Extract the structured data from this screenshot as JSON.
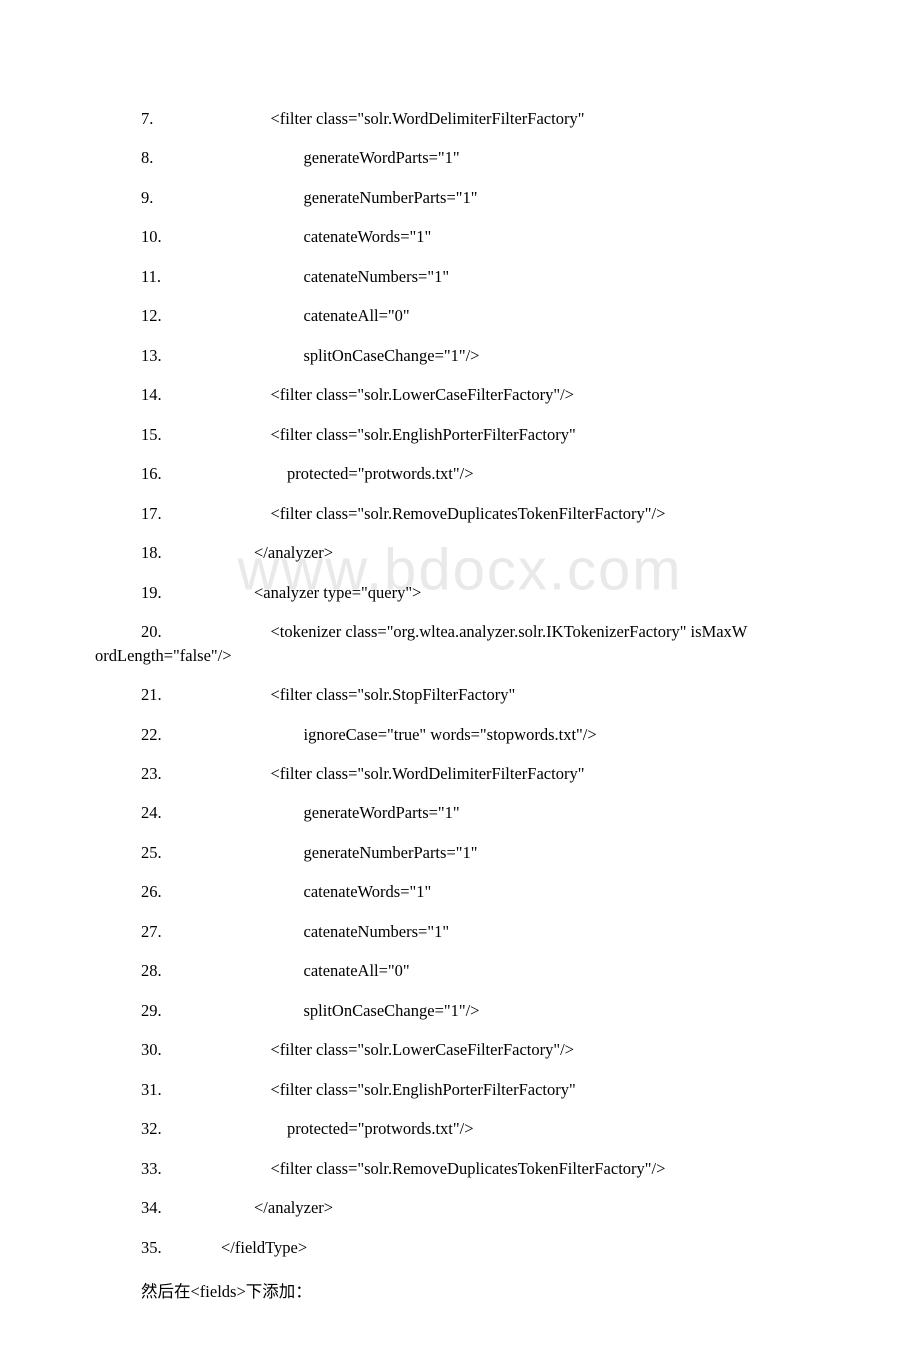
{
  "watermark": "www.bdocx.com",
  "lines": [
    {
      "n": "7",
      "t": "            <filter class=\"solr.WordDelimiterFilterFactory\""
    },
    {
      "n": "8",
      "t": "                    generateWordParts=\"1\""
    },
    {
      "n": "9",
      "t": "                    generateNumberParts=\"1\""
    },
    {
      "n": "10",
      "t": "                    catenateWords=\"1\""
    },
    {
      "n": "11",
      "t": "                    catenateNumbers=\"1\""
    },
    {
      "n": "12",
      "t": "                    catenateAll=\"0\""
    },
    {
      "n": "13",
      "t": "                    splitOnCaseChange=\"1\"/>"
    },
    {
      "n": "14",
      "t": "            <filter class=\"solr.LowerCaseFilterFactory\"/>"
    },
    {
      "n": "15",
      "t": "            <filter class=\"solr.EnglishPorterFilterFactory\""
    },
    {
      "n": "16",
      "t": "                protected=\"protwords.txt\"/>"
    },
    {
      "n": "17",
      "t": "            <filter class=\"solr.RemoveDuplicatesTokenFilterFactory\"/>"
    },
    {
      "n": "18",
      "t": "        </analyzer>"
    },
    {
      "n": "19",
      "t": "        <analyzer type=\"query\">"
    },
    {
      "n": "20",
      "t": "            <tokenizer class=\"org.wltea.analyzer.solr.IKTokenizerFactory\" isMaxW",
      "wrap": "ordLength=\"false\"/>"
    },
    {
      "n": "21",
      "t": "            <filter class=\"solr.StopFilterFactory\""
    },
    {
      "n": "22",
      "t": "                    ignoreCase=\"true\" words=\"stopwords.txt\"/>"
    },
    {
      "n": "23",
      "t": "            <filter class=\"solr.WordDelimiterFilterFactory\""
    },
    {
      "n": "24",
      "t": "                    generateWordParts=\"1\""
    },
    {
      "n": "25",
      "t": "                    generateNumberParts=\"1\""
    },
    {
      "n": "26",
      "t": "                    catenateWords=\"1\""
    },
    {
      "n": "27",
      "t": "                    catenateNumbers=\"1\""
    },
    {
      "n": "28",
      "t": "                    catenateAll=\"0\""
    },
    {
      "n": "29",
      "t": "                    splitOnCaseChange=\"1\"/>"
    },
    {
      "n": "30",
      "t": "            <filter class=\"solr.LowerCaseFilterFactory\"/>"
    },
    {
      "n": "31",
      "t": "            <filter class=\"solr.EnglishPorterFilterFactory\""
    },
    {
      "n": "32",
      "t": "                protected=\"protwords.txt\"/>"
    },
    {
      "n": "33",
      "t": "            <filter class=\"solr.RemoveDuplicatesTokenFilterFactory\"/>"
    },
    {
      "n": "34",
      "t": "        </analyzer>"
    },
    {
      "n": "35",
      "t": "</fieldType>"
    }
  ],
  "prose": "然后在<fields>下添加："
}
